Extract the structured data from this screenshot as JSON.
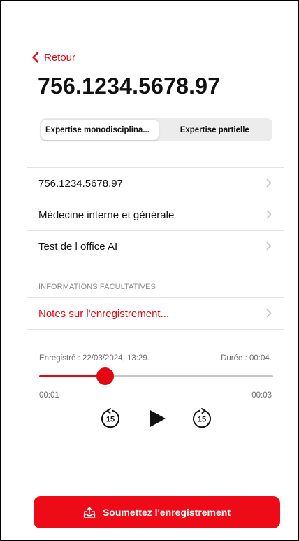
{
  "nav": {
    "back_label": "Retour"
  },
  "header": {
    "title": "756.1234.5678.97"
  },
  "segmented": {
    "options": [
      "Expertise monodisciplina...",
      "Expertise partielle"
    ],
    "selected_index": 0
  },
  "list": {
    "items": [
      {
        "label": "756.1234.5678.97"
      },
      {
        "label": "Médecine interne et générale"
      },
      {
        "label": "Test de l office AI"
      }
    ]
  },
  "optional": {
    "header": "INFORMATIONS FACULTATIVES",
    "notes_label": "Notes sur l'enregistrement..."
  },
  "player": {
    "recorded_label": "Enregistré : 22/03/2024, 13:29.",
    "duration_label": "Durée : 00:04.",
    "elapsed": "00:01",
    "remaining": "00:03",
    "progress": 0.28,
    "skip_back_seconds": "15",
    "skip_forward_seconds": "15"
  },
  "submit": {
    "label": "Soumettez l'enregistrement"
  },
  "colors": {
    "accent": "#e30613",
    "button": "#ee0a16",
    "muted_text": "#6e6e6e",
    "divider": "#e2e2e2"
  },
  "icons": {
    "back": "chevron-left-icon",
    "row": "chevron-right-icon",
    "skip_back": "skip-back-15-icon",
    "play": "play-icon",
    "skip_forward": "skip-forward-15-icon",
    "submit": "upload-tray-icon"
  }
}
